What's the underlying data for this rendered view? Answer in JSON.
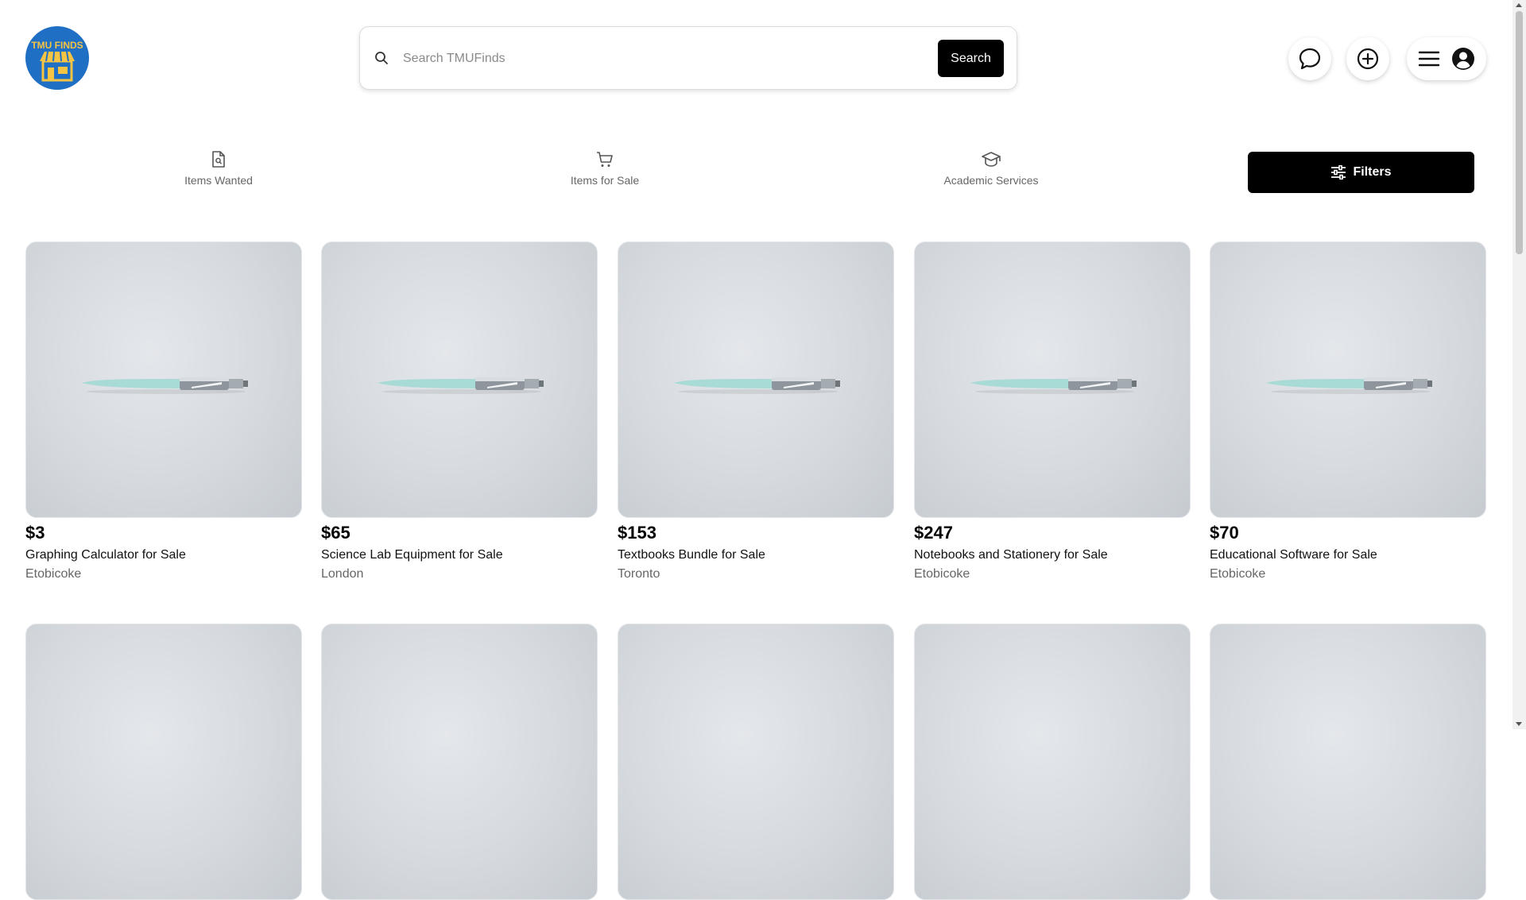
{
  "logo": {
    "text": "TMU FINDS"
  },
  "search": {
    "placeholder": "Search TMUFinds",
    "value": "",
    "button_label": "Search"
  },
  "header_icons": [
    "chat-icon",
    "add-icon",
    "menu-icon",
    "user-icon"
  ],
  "categories": [
    {
      "label": "Items Wanted",
      "icon": "document-search-icon"
    },
    {
      "label": "Items for Sale",
      "icon": "cart-icon"
    },
    {
      "label": "Academic Services",
      "icon": "graduation-cap-icon"
    }
  ],
  "filters": {
    "label": "Filters",
    "icon": "sliders-icon"
  },
  "listings": [
    {
      "price": "$3",
      "title": "Graphing Calculator for Sale",
      "location": "Etobicoke"
    },
    {
      "price": "$65",
      "title": "Science Lab Equipment for Sale",
      "location": "London"
    },
    {
      "price": "$153",
      "title": "Textbooks Bundle for Sale",
      "location": "Toronto"
    },
    {
      "price": "$247",
      "title": "Notebooks and Stationery for Sale",
      "location": "Etobicoke"
    },
    {
      "price": "$70",
      "title": "Educational Software for Sale",
      "location": "Etobicoke"
    }
  ],
  "colors": {
    "accent": "#000000",
    "logo_bg": "#1f6fc4",
    "logo_fg": "#f6c445"
  }
}
